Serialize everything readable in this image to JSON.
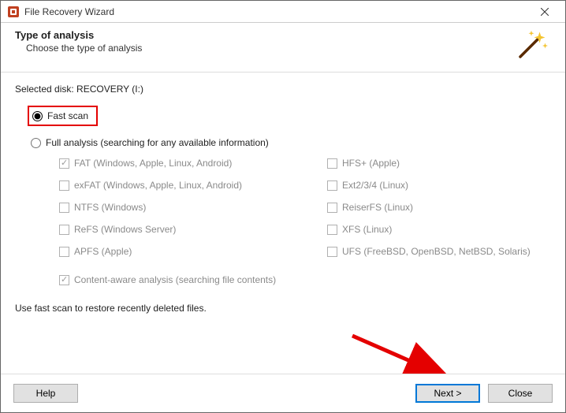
{
  "window": {
    "title": "File Recovery Wizard"
  },
  "header": {
    "title": "Type of analysis",
    "subtitle": "Choose the type of analysis"
  },
  "selected_disk_label": "Selected disk: RECOVERY (I:)",
  "scan": {
    "fast_label": "Fast scan",
    "full_label": "Full analysis (searching for any available information)"
  },
  "filesystems": {
    "left": [
      {
        "label": "FAT (Windows, Apple, Linux, Android)",
        "checked": true
      },
      {
        "label": "exFAT (Windows, Apple, Linux, Android)",
        "checked": false
      },
      {
        "label": "NTFS (Windows)",
        "checked": false
      },
      {
        "label": "ReFS (Windows Server)",
        "checked": false
      },
      {
        "label": "APFS (Apple)",
        "checked": false
      }
    ],
    "right": [
      {
        "label": "HFS+ (Apple)",
        "checked": false
      },
      {
        "label": "Ext2/3/4 (Linux)",
        "checked": false
      },
      {
        "label": "ReiserFS (Linux)",
        "checked": false
      },
      {
        "label": "XFS (Linux)",
        "checked": false
      },
      {
        "label": "UFS (FreeBSD, OpenBSD, NetBSD, Solaris)",
        "checked": false
      }
    ]
  },
  "content_aware_label": "Content-aware analysis (searching file contents)",
  "hint": "Use fast scan to restore recently deleted files.",
  "buttons": {
    "help": "Help",
    "next": "Next >",
    "close": "Close"
  }
}
